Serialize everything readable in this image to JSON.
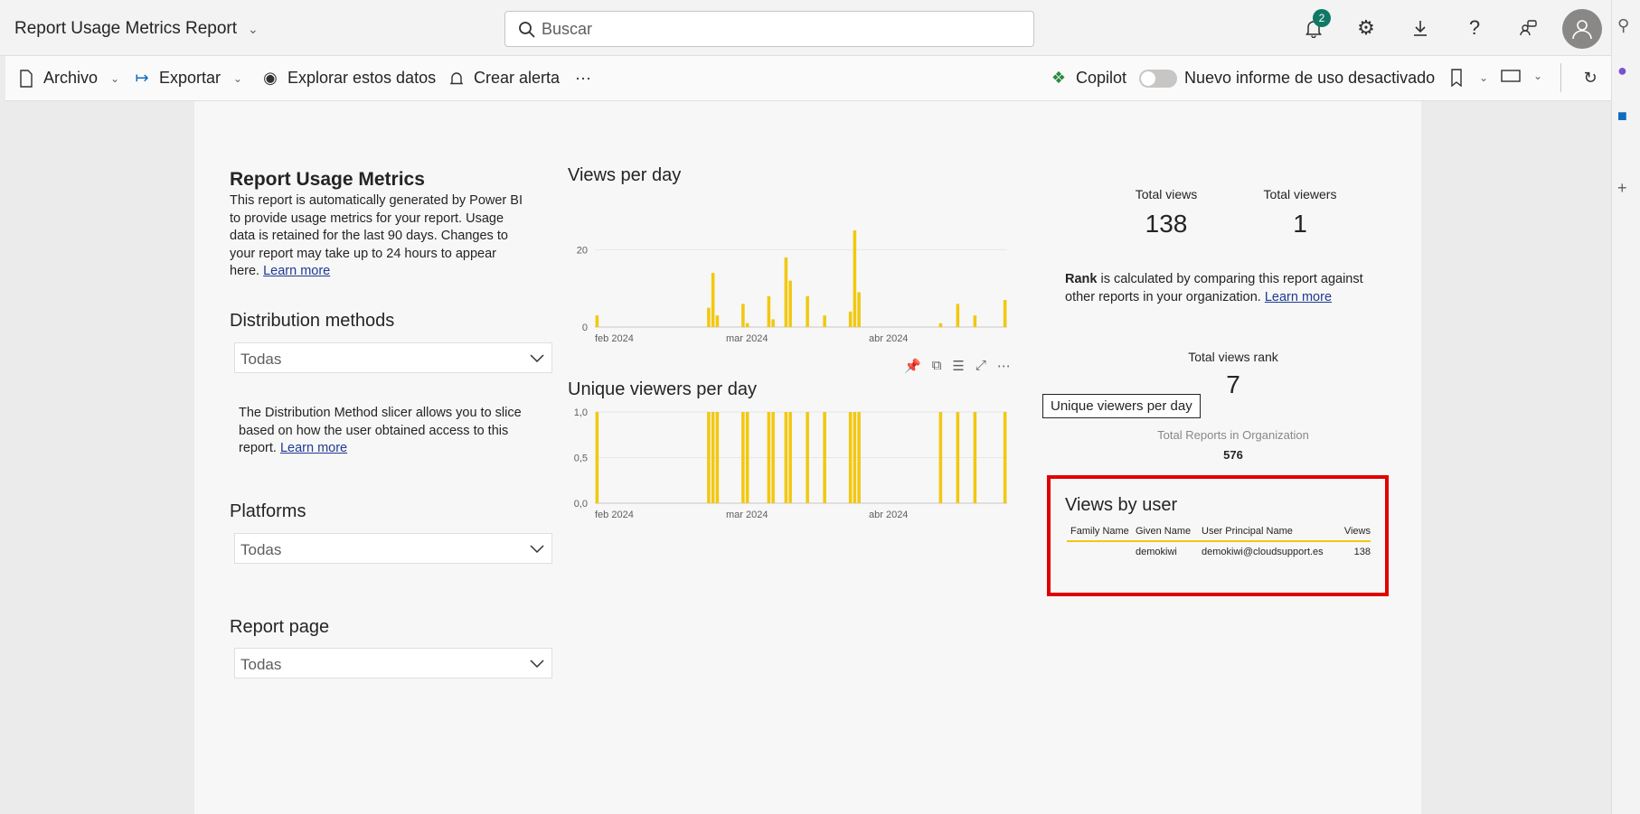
{
  "app": {
    "title": "Report Usage Metrics Report",
    "search_placeholder": "Buscar",
    "notifications_count": "2"
  },
  "toolbar": {
    "file": "Archivo",
    "export": "Exportar",
    "explore": "Explorar estos datos",
    "alert": "Crear alerta",
    "more": "···",
    "copilot": "Copilot",
    "new_usage_toggle": "Nuevo informe de uso desactivado"
  },
  "intro": {
    "title": "Report Usage Metrics",
    "text": "This report is automatically generated by Power BI to provide usage metrics for your report. Usage data is retained for the last 90 days. Changes to your report may take up to 24 hours to appear here.",
    "link": "Learn more"
  },
  "slicers": {
    "distribution": {
      "title": "Distribution methods",
      "value": "Todas"
    },
    "distribution_note": {
      "text": "The Distribution Method slicer allows you to slice based on how the user obtained access to this report.",
      "link": "Learn more"
    },
    "platforms": {
      "title": "Platforms",
      "value": "Todas"
    },
    "report_page": {
      "title": "Report page",
      "value": "Todas"
    }
  },
  "kpis": {
    "total_views_label": "Total views",
    "total_views": "138",
    "total_viewers_label": "Total viewers",
    "total_viewers": "1",
    "rank_bold": "Rank",
    "rank_text": " is calculated by comparing this report against other reports in your organization.",
    "rank_link": "Learn more",
    "rank_label": "Total views rank",
    "rank_value": "7",
    "total_reports_label": "Total Reports in Organization",
    "total_reports_value": "576"
  },
  "tooltip": "Unique viewers per day",
  "views_by_user": {
    "title": "Views by user",
    "columns": [
      "Family Name",
      "Given Name",
      "User Principal Name",
      "Views"
    ],
    "rows": [
      [
        "",
        "demokiwi",
        "demokiwi@cloudsupport.es",
        "138"
      ]
    ]
  },
  "colors": {
    "bar": "#f2c811",
    "highlight_border": "#e00000"
  },
  "chart_data": [
    {
      "type": "bar",
      "title": "Views per day",
      "x_tick_labels": [
        "feb 2024",
        "mar 2024",
        "abr 2024"
      ],
      "y_tick_labels": [
        "0",
        "20"
      ],
      "ylim": [
        0,
        25
      ],
      "grid": true,
      "values": [
        3,
        0,
        0,
        0,
        0,
        0,
        0,
        0,
        0,
        0,
        0,
        0,
        0,
        0,
        0,
        0,
        0,
        0,
        0,
        0,
        0,
        0,
        0,
        0,
        0,
        0,
        5,
        14,
        3,
        0,
        0,
        0,
        0,
        0,
        6,
        1,
        0,
        0,
        0,
        0,
        8,
        2,
        0,
        0,
        18,
        12,
        0,
        0,
        0,
        8,
        0,
        0,
        0,
        3,
        0,
        0,
        0,
        0,
        0,
        4,
        25,
        9,
        0,
        0,
        0,
        0,
        0,
        0,
        0,
        0,
        0,
        0,
        0,
        0,
        0,
        0,
        0,
        0,
        0,
        0,
        1,
        0,
        0,
        0,
        6,
        0,
        0,
        0,
        3,
        0,
        0,
        0,
        0,
        0,
        0,
        7
      ]
    },
    {
      "type": "bar",
      "title": "Unique viewers per day",
      "x_tick_labels": [
        "feb 2024",
        "mar 2024",
        "abr 2024"
      ],
      "y_tick_labels": [
        "0,0",
        "0,5",
        "1,0"
      ],
      "ylim": [
        0,
        1
      ],
      "grid": true,
      "values": [
        1,
        0,
        0,
        0,
        0,
        0,
        0,
        0,
        0,
        0,
        0,
        0,
        0,
        0,
        0,
        0,
        0,
        0,
        0,
        0,
        0,
        0,
        0,
        0,
        0,
        0,
        1,
        1,
        1,
        0,
        0,
        0,
        0,
        0,
        1,
        1,
        0,
        0,
        0,
        0,
        1,
        1,
        0,
        0,
        1,
        1,
        0,
        0,
        0,
        1,
        0,
        0,
        0,
        1,
        0,
        0,
        0,
        0,
        0,
        1,
        1,
        1,
        0,
        0,
        0,
        0,
        0,
        0,
        0,
        0,
        0,
        0,
        0,
        0,
        0,
        0,
        0,
        0,
        0,
        0,
        1,
        0,
        0,
        0,
        1,
        0,
        0,
        0,
        1,
        0,
        0,
        0,
        0,
        0,
        0,
        1
      ]
    }
  ]
}
